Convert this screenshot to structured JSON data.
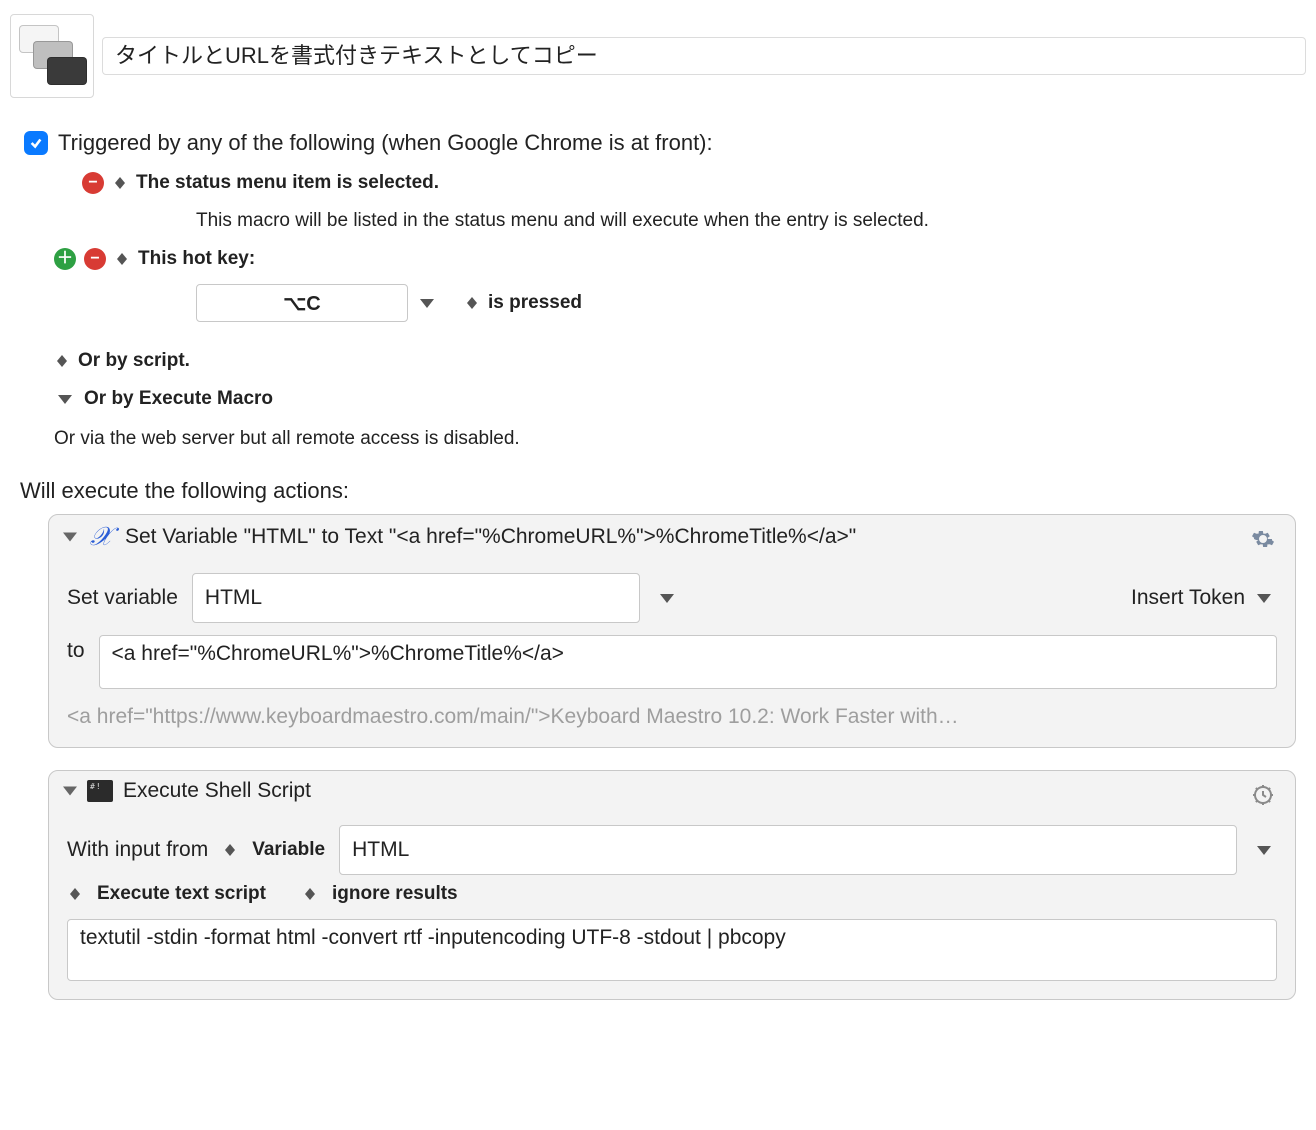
{
  "header": {
    "macro_title": "タイトルとURLを書式付きテキストとしてコピー"
  },
  "triggers": {
    "header": "Triggered by any of the following (when Google Chrome is at front):",
    "status_menu": {
      "title": "The status menu item is selected.",
      "explain": "This macro will be listed in the status menu and will execute when the entry is selected."
    },
    "hotkey": {
      "title": "This hot key:",
      "key_display": "⌥C",
      "state_label": "is pressed"
    },
    "by_script": "Or by script.",
    "by_execute_macro": "Or by Execute Macro",
    "remote_disabled": "Or via the web server but all remote access is disabled."
  },
  "actions_label": "Will execute the following actions:",
  "actions": {
    "set_variable": {
      "title": "Set Variable \"HTML\" to Text \"<a href=\"%ChromeURL%\">%ChromeTitle%</a>\"",
      "row1_label": "Set variable",
      "variable_name": "HTML",
      "insert_token": "Insert Token",
      "row2_label": "to",
      "value_text": "<a href=\"%ChromeURL%\">%ChromeTitle%</a>",
      "preview": "<a href=\"https://www.keyboardmaestro.com/main/\">Keyboard Maestro 10.2: Work Faster with…"
    },
    "shell": {
      "title": "Execute Shell Script",
      "with_input_label": "With input from",
      "input_source": "Variable",
      "input_variable": "HTML",
      "exec_mode": "Execute text script",
      "result_mode": "ignore results",
      "script": "textutil -stdin -format html -convert rtf -inputencoding UTF-8 -stdout | pbcopy"
    }
  }
}
